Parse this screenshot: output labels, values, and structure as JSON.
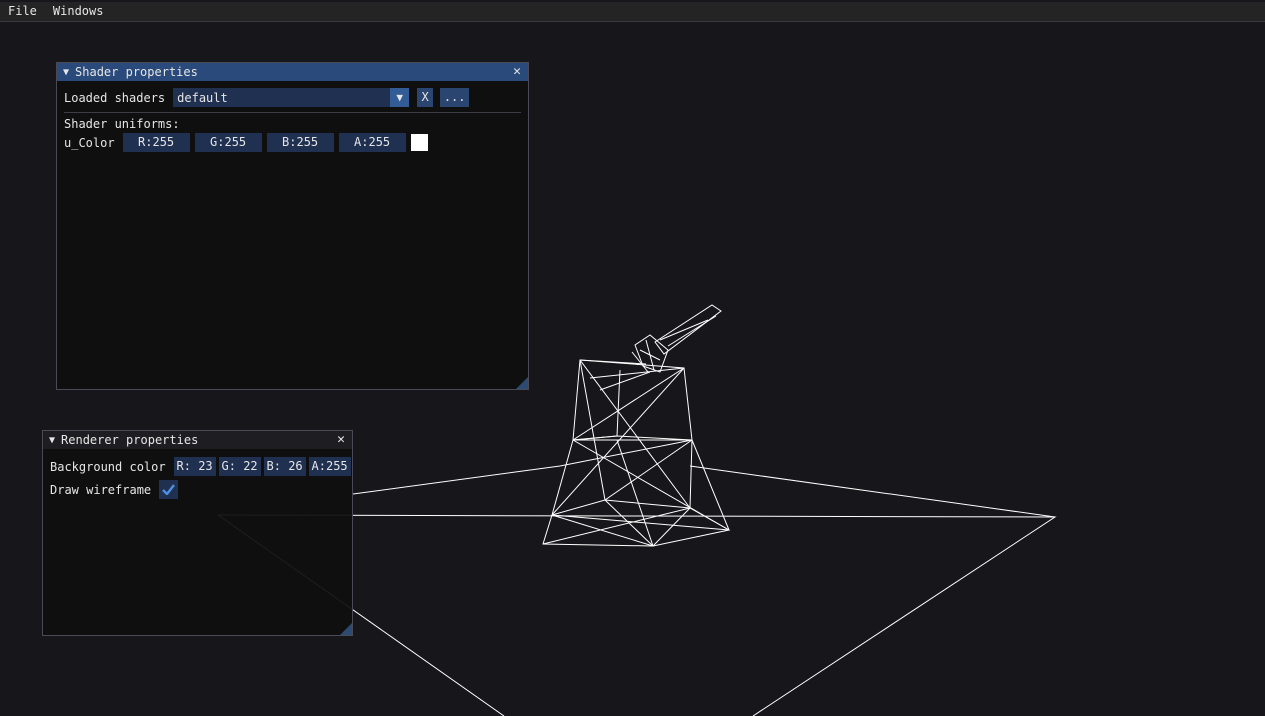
{
  "menubar": {
    "items": [
      "File",
      "Windows"
    ]
  },
  "shader_window": {
    "title": "Shader properties",
    "loaded_shaders_label": "Loaded shaders",
    "selected_shader": "default",
    "clear_button": "X",
    "browse_button": "...",
    "uniforms_heading": "Shader uniforms:",
    "uniform_name": "u_Color",
    "channels": [
      "R:255",
      "G:255",
      "B:255",
      "A:255"
    ],
    "swatch_color": "#ffffff"
  },
  "renderer_window": {
    "title": "Renderer properties",
    "bg_color_label": "Background color",
    "bg_channels": [
      "R: 23",
      "G: 22",
      "B: 26",
      "A:255"
    ],
    "wireframe_label": "Draw wireframe",
    "wireframe_enabled": true
  },
  "colors": {
    "background": "#17161a",
    "titlebar": "#294a7a",
    "frame": "#1f3050",
    "accent": "#335c97",
    "wireframe": "#ffffff"
  }
}
